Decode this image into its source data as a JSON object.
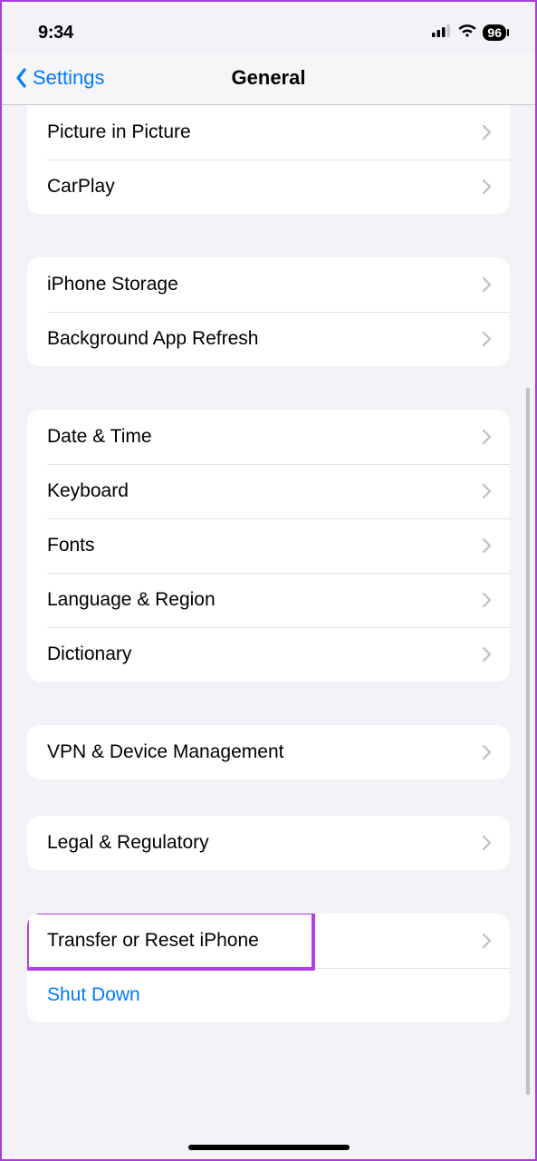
{
  "status": {
    "time": "9:34",
    "battery": "96"
  },
  "nav": {
    "back_label": "Settings",
    "title": "General"
  },
  "groups": [
    {
      "rows": [
        {
          "id": "picture-in-picture",
          "label": "Picture in Picture",
          "chevron": true
        },
        {
          "id": "carplay",
          "label": "CarPlay",
          "chevron": true
        }
      ]
    },
    {
      "rows": [
        {
          "id": "iphone-storage",
          "label": "iPhone Storage",
          "chevron": true
        },
        {
          "id": "background-app-refresh",
          "label": "Background App Refresh",
          "chevron": true
        }
      ]
    },
    {
      "rows": [
        {
          "id": "date-time",
          "label": "Date & Time",
          "chevron": true
        },
        {
          "id": "keyboard",
          "label": "Keyboard",
          "chevron": true
        },
        {
          "id": "fonts",
          "label": "Fonts",
          "chevron": true
        },
        {
          "id": "language-region",
          "label": "Language & Region",
          "chevron": true
        },
        {
          "id": "dictionary",
          "label": "Dictionary",
          "chevron": true
        }
      ]
    },
    {
      "rows": [
        {
          "id": "vpn-device-management",
          "label": "VPN & Device Management",
          "chevron": true
        }
      ]
    },
    {
      "rows": [
        {
          "id": "legal-regulatory",
          "label": "Legal & Regulatory",
          "chevron": true
        }
      ]
    },
    {
      "rows": [
        {
          "id": "transfer-or-reset-iphone",
          "label": "Transfer or Reset iPhone",
          "chevron": true,
          "highlighted": true
        },
        {
          "id": "shut-down",
          "label": "Shut Down",
          "chevron": false,
          "link": true
        }
      ]
    }
  ],
  "colors": {
    "accent": "#007aff",
    "highlight": "#b23fe0",
    "bg": "#f2f2f7"
  }
}
